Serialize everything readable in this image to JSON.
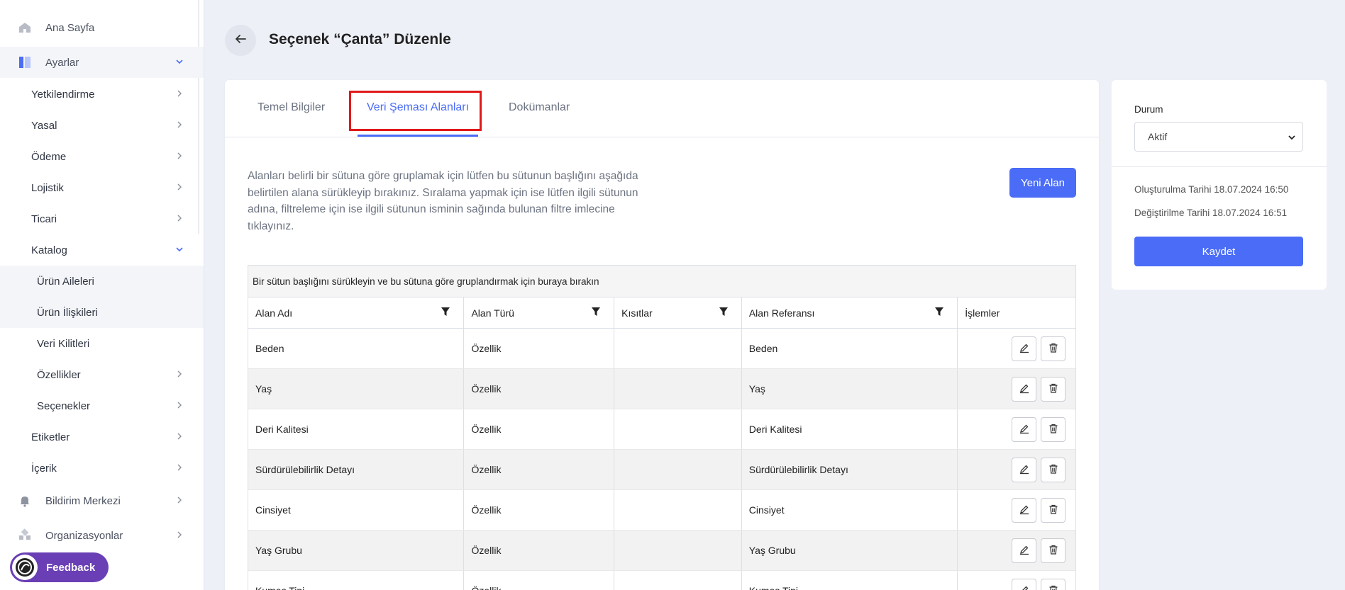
{
  "sidebar": {
    "items": [
      {
        "label": "Ana Sayfa",
        "icon": "home-icon"
      },
      {
        "label": "Ayarlar",
        "icon": "settings-panel-icon"
      },
      {
        "label": "Yetkilendirme"
      },
      {
        "label": "Yasal"
      },
      {
        "label": "Ödeme"
      },
      {
        "label": "Lojistik"
      },
      {
        "label": "Ticari"
      },
      {
        "label": "Katalog"
      },
      {
        "label": "Ürün Aileleri"
      },
      {
        "label": "Ürün İlişkileri"
      },
      {
        "label": "Veri Kilitleri"
      },
      {
        "label": "Özellikler"
      },
      {
        "label": "Seçenekler"
      },
      {
        "label": "Etiketler"
      },
      {
        "label": "İçerik"
      },
      {
        "label": "Bildirim Merkezi",
        "icon": "bell-icon"
      },
      {
        "label": "Organizasyonlar",
        "icon": "organization-icon"
      }
    ]
  },
  "header": {
    "title": "Seçenek “Çanta” Düzenle"
  },
  "tabs": [
    {
      "label": "Temel Bilgiler"
    },
    {
      "label": "Veri Şeması Alanları",
      "active": true
    },
    {
      "label": "Dokümanlar"
    }
  ],
  "main": {
    "description": "Alanları belirli bir sütuna göre gruplamak için lütfen bu sütunun başlığını aşağıda belirtilen alana sürükleyip bırakınız. Sıralama yapmak için ise lütfen ilgili sütunun adına, filtreleme için ise ilgili sütunun isminin sağında bulunan filtre imlecine tıklayınız.",
    "new_button": "Yeni Alan"
  },
  "grid": {
    "group_panel": "Bir sütun başlığını sürükleyin ve bu sütuna göre gruplandırmak için buraya bırakın",
    "columns": [
      "Alan Adı",
      "Alan Türü",
      "Kısıtlar",
      "Alan Referansı",
      "İşlemler"
    ],
    "rows": [
      [
        "Beden",
        "Özellik",
        "",
        "Beden"
      ],
      [
        "Yaş",
        "Özellik",
        "",
        "Yaş"
      ],
      [
        "Deri Kalitesi",
        "Özellik",
        "",
        "Deri Kalitesi"
      ],
      [
        "Sürdürülebilirlik Detayı",
        "Özellik",
        "",
        "Sürdürülebilirlik Detayı"
      ],
      [
        "Cinsiyet",
        "Özellik",
        "",
        "Cinsiyet"
      ],
      [
        "Yaş Grubu",
        "Özellik",
        "",
        "Yaş Grubu"
      ],
      [
        "Kumaş Tipi",
        "Özellik",
        "",
        "Kumaş Tipi"
      ]
    ]
  },
  "side": {
    "status_label": "Durum",
    "status_value": "Aktif",
    "created": "Oluşturulma Tarihi 18.07.2024 16:50",
    "modified": "Değiştirilme Tarihi 18.07.2024 16:51",
    "save": "Kaydet"
  },
  "feedback": {
    "label": "Feedback"
  },
  "colors": {
    "accent": "#4a6cf7",
    "highlight": "#e0191b",
    "feedback": "#6a3fb5"
  }
}
